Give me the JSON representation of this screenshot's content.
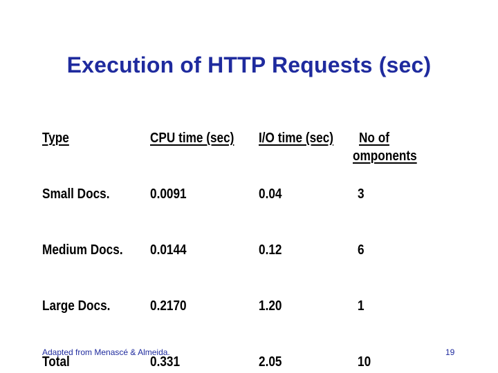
{
  "title": "Execution of HTTP Requests (sec)",
  "table": {
    "headers": {
      "type": "Type",
      "cpu": "CPU time (sec)",
      "io": "I/O time (sec)",
      "components_line1": "No of",
      "components_line2": "omponents"
    },
    "rows": [
      {
        "type": "Small Docs.",
        "cpu": "0.0091",
        "io": "0.04",
        "components": "3"
      },
      {
        "type": "Medium Docs.",
        "cpu": "0.0144",
        "io": "0.12",
        "components": "6"
      },
      {
        "type": "Large Docs.",
        "cpu": "0.2170",
        "io": "1.20",
        "components": "1"
      },
      {
        "type": "Total",
        "cpu": "0.331",
        "io": "2.05",
        "components": "10"
      }
    ]
  },
  "footer": "Adapted from Menascé & Almeida.",
  "page_number": "19"
}
